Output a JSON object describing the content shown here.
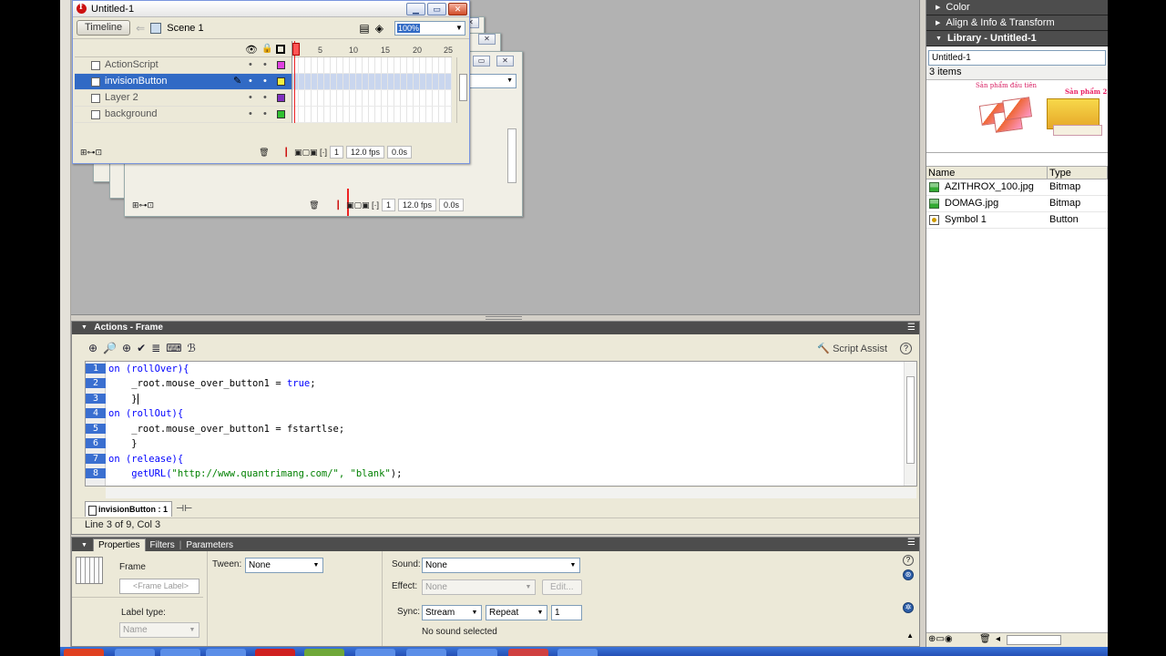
{
  "document": {
    "title": "Untitled-1",
    "timeline_button": "Timeline",
    "scene": "Scene 1",
    "zoom": "100%",
    "ruler_marks": [
      "5",
      "10",
      "15",
      "20",
      "25"
    ],
    "layers": [
      {
        "name": "ActionScript",
        "color": "#e040e0"
      },
      {
        "name": "invisionButton",
        "color": "#f0f040",
        "selected": true
      },
      {
        "name": "Layer 2",
        "color": "#8030c0"
      },
      {
        "name": "background",
        "color": "#30c030"
      }
    ],
    "frame_number": "1",
    "fps": "12.0 fps",
    "time": "0.0s"
  },
  "ghost_window": {
    "frame_number": "1",
    "fps": "12.0 fps",
    "time": "0.0s"
  },
  "right_panel": {
    "color_header": "Color",
    "align_header": "Align & Info & Transform",
    "library_header": "Library - Untitled-1",
    "library_select": "Untitled-1",
    "item_count": "3 items",
    "preview_text_1": "Sản phẩm đầu tiên",
    "preview_text_2": "Sản phẩm 2",
    "col_name": "Name",
    "col_type": "Type",
    "items": [
      {
        "name": "AZITHROX_100.jpg",
        "type": "Bitmap",
        "icon": "bitmap-icon"
      },
      {
        "name": "DOMAG.jpg",
        "type": "Bitmap",
        "icon": "bitmap-icon"
      },
      {
        "name": "Symbol 1",
        "type": "Button",
        "icon": "button-symbol-icon"
      }
    ]
  },
  "actions": {
    "title": "Actions - Frame",
    "script_assist": "Script Assist",
    "line_numbers": [
      "1",
      "2",
      "3",
      "4",
      "5",
      "6",
      "7",
      "8"
    ],
    "code": [
      {
        "a": "on ",
        "b": "(rollOver){",
        "c": ""
      },
      {
        "a": "    _root.mouse_over_button1 = ",
        "b": "true",
        "c": ";"
      },
      {
        "a": "    }",
        "b": "",
        "c": ""
      },
      {
        "a": "on ",
        "b": "(rollOut){",
        "c": ""
      },
      {
        "a": "    _root.mouse_over_button1 = fstartlse;",
        "b": "",
        "c": ""
      },
      {
        "a": "    }",
        "b": "",
        "c": ""
      },
      {
        "a": "on ",
        "b": "(release){",
        "c": ""
      },
      {
        "a": "    getURL(",
        "b": "\"http://www.quantrimang.com/\", \"blank\"",
        "c": ");"
      }
    ],
    "script_tab": "invisionButton : 1",
    "status": "Line 3 of 9, Col 3"
  },
  "properties": {
    "tabs": [
      "Properties",
      "Filters",
      "Parameters"
    ],
    "frame_label": "Frame",
    "frame_label_placeholder": "<Frame Label>",
    "label_type_label": "Label type:",
    "label_type_value": "Name",
    "tween_label": "Tween:",
    "tween_value": "None",
    "sound_label": "Sound:",
    "sound_value": "None",
    "effect_label": "Effect:",
    "effect_value": "None",
    "edit_button": "Edit...",
    "sync_label": "Sync:",
    "sync_value": "Stream",
    "repeat_value": "Repeat",
    "repeat_count": "1",
    "no_sound": "No sound selected"
  }
}
